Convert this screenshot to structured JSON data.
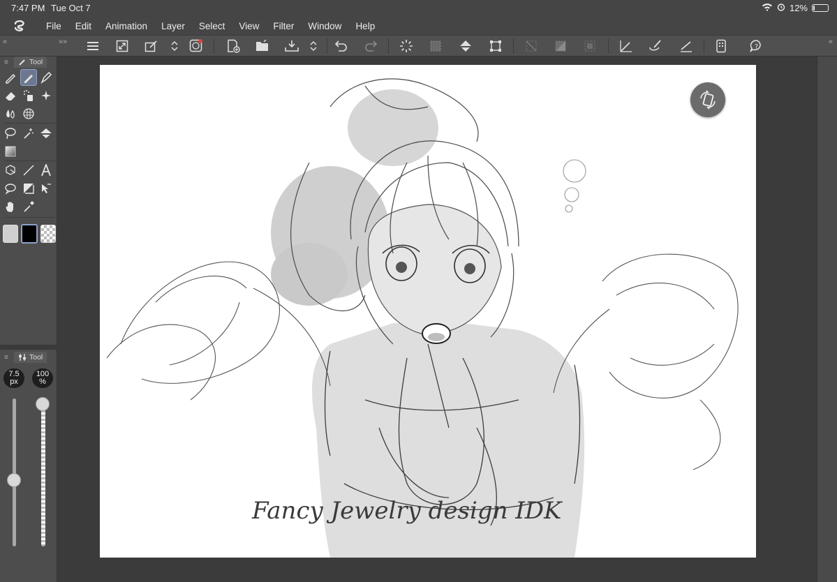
{
  "status_bar": {
    "time": "7:47 PM",
    "date": "Tue Oct 7",
    "battery": "12%",
    "battery_level": 0.12
  },
  "menu": {
    "items": [
      "File",
      "Edit",
      "Animation",
      "Layer",
      "Select",
      "View",
      "Filter",
      "Window",
      "Help"
    ]
  },
  "toolbar": {
    "icons": [
      "menu-icon",
      "fullscreen-icon",
      "settings-icon",
      "record-icon",
      "new-canvas-icon",
      "open-icon",
      "export-icon",
      "undo-icon",
      "redo-icon",
      "loading-icon",
      "selection-clear-icon",
      "fill-icon",
      "transform-icon",
      "deselect-icon",
      "invert-selection-icon",
      "selection-border-icon",
      "correct-line-icon",
      "brush-smoothing-icon",
      "ruler-icon",
      "companion-icon",
      "help-icon"
    ]
  },
  "tool_panel": {
    "tab_label": "Tool",
    "tools": [
      "pen-tool-icon",
      "pencil-tool-icon",
      "ink-pen-icon",
      "eraser-icon",
      "spray-icon",
      "sparkle-icon",
      "blend-icon",
      "grid-icon",
      "lasso-icon",
      "magic-wand-icon",
      "bucket-icon",
      "gradient-icon",
      "3d-object-icon",
      "line-tool-icon",
      "text-tool-icon",
      "balloon-icon",
      "frame-icon",
      "operation-icon",
      "hand-icon",
      "eyedropper-icon"
    ],
    "active_tool": "pencil-tool-icon",
    "colors": {
      "sub": "#d0d0d0",
      "main": "#000000"
    }
  },
  "property_panel": {
    "tab_label": "Tool",
    "brush_size": {
      "value": "7.5",
      "unit": "px",
      "level": 0.45
    },
    "opacity": {
      "value": "100",
      "unit": "%",
      "level": 1.0
    }
  },
  "canvas": {
    "watermark": "Fancy Jewelry design IDK",
    "background": "#ffffff"
  }
}
